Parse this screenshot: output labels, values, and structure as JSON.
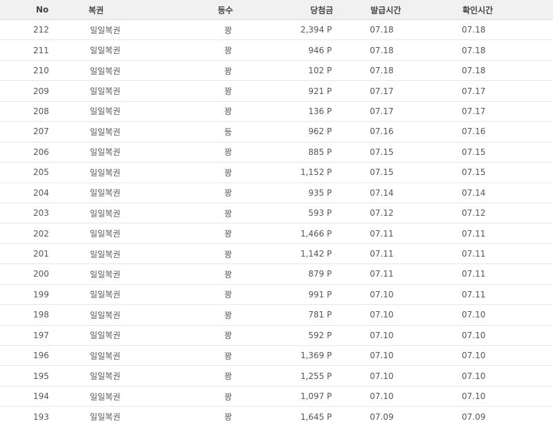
{
  "headers": {
    "no": "No",
    "ticket": "복권",
    "rank": "등수",
    "amount": "당첨금",
    "issued": "발급시간",
    "checked": "확인시간"
  },
  "rows": [
    {
      "no": "212",
      "ticket": "일일복권",
      "rank": "꽝",
      "amount": "2,394 P",
      "issued": "07.18",
      "checked": "07.18"
    },
    {
      "no": "211",
      "ticket": "일일복권",
      "rank": "꽝",
      "amount": "946 P",
      "issued": "07.18",
      "checked": "07.18"
    },
    {
      "no": "210",
      "ticket": "일일복권",
      "rank": "꽝",
      "amount": "102 P",
      "issued": "07.18",
      "checked": "07.18"
    },
    {
      "no": "209",
      "ticket": "일일복권",
      "rank": "꽝",
      "amount": "921 P",
      "issued": "07.17",
      "checked": "07.17"
    },
    {
      "no": "208",
      "ticket": "일일복권",
      "rank": "꽝",
      "amount": "136 P",
      "issued": "07.17",
      "checked": "07.17"
    },
    {
      "no": "207",
      "ticket": "일일복권",
      "rank": "등",
      "amount": "962 P",
      "issued": "07.16",
      "checked": "07.16"
    },
    {
      "no": "206",
      "ticket": "일일복권",
      "rank": "꽝",
      "amount": "885 P",
      "issued": "07.15",
      "checked": "07.15"
    },
    {
      "no": "205",
      "ticket": "일일복권",
      "rank": "꽝",
      "amount": "1,152 P",
      "issued": "07.15",
      "checked": "07.15"
    },
    {
      "no": "204",
      "ticket": "일일복권",
      "rank": "꽝",
      "amount": "935 P",
      "issued": "07.14",
      "checked": "07.14"
    },
    {
      "no": "203",
      "ticket": "일일복권",
      "rank": "꽝",
      "amount": "593 P",
      "issued": "07.12",
      "checked": "07.12"
    },
    {
      "no": "202",
      "ticket": "일일복권",
      "rank": "꽝",
      "amount": "1,466 P",
      "issued": "07.11",
      "checked": "07.11"
    },
    {
      "no": "201",
      "ticket": "일일복권",
      "rank": "꽝",
      "amount": "1,142 P",
      "issued": "07.11",
      "checked": "07.11"
    },
    {
      "no": "200",
      "ticket": "일일복권",
      "rank": "꽝",
      "amount": "879 P",
      "issued": "07.11",
      "checked": "07.11"
    },
    {
      "no": "199",
      "ticket": "일일복권",
      "rank": "꽝",
      "amount": "991 P",
      "issued": "07.10",
      "checked": "07.11"
    },
    {
      "no": "198",
      "ticket": "일일복권",
      "rank": "꽝",
      "amount": "781 P",
      "issued": "07.10",
      "checked": "07.10"
    },
    {
      "no": "197",
      "ticket": "일일복권",
      "rank": "꽝",
      "amount": "592 P",
      "issued": "07.10",
      "checked": "07.10"
    },
    {
      "no": "196",
      "ticket": "일일복권",
      "rank": "꽝",
      "amount": "1,369 P",
      "issued": "07.10",
      "checked": "07.10"
    },
    {
      "no": "195",
      "ticket": "일일복권",
      "rank": "꽝",
      "amount": "1,255 P",
      "issued": "07.10",
      "checked": "07.10"
    },
    {
      "no": "194",
      "ticket": "일일복권",
      "rank": "꽝",
      "amount": "1,097 P",
      "issued": "07.10",
      "checked": "07.10"
    },
    {
      "no": "193",
      "ticket": "일일복권",
      "rank": "꽝",
      "amount": "1,645 P",
      "issued": "07.09",
      "checked": "07.09"
    }
  ]
}
